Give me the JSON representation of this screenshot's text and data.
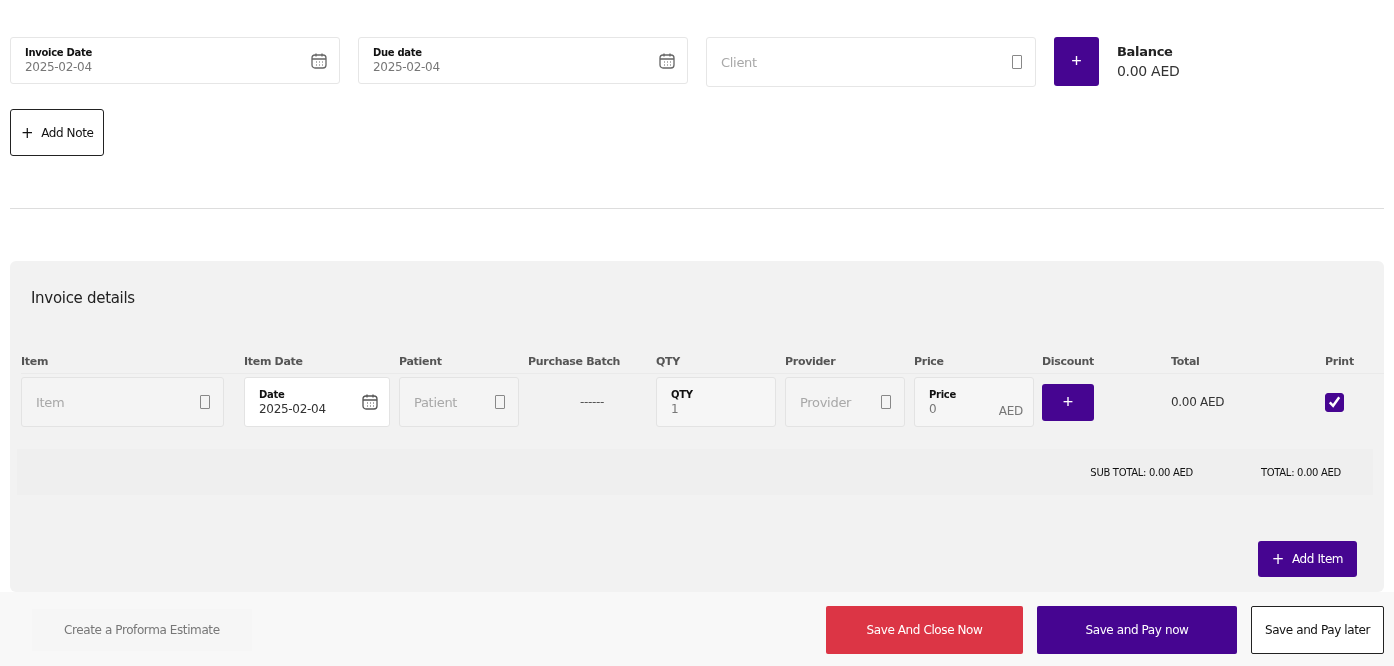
{
  "header": {
    "invoice_date": {
      "label": "Invoice Date",
      "value": "2025-02-04"
    },
    "due_date": {
      "label": "Due date",
      "value": "2025-02-04"
    },
    "client": {
      "placeholder": "Client"
    },
    "add_client_button": "+",
    "balance": {
      "label": "Balance",
      "value": "0.00 AED"
    },
    "add_note_button": {
      "icon": "+",
      "label": "Add Note"
    }
  },
  "invoice_details": {
    "title": "Invoice details",
    "columns": [
      "Item",
      "Item Date",
      "Patient",
      "Purchase Batch",
      "QTY",
      "Provider",
      "Price",
      "Discount",
      "Total",
      "Print"
    ],
    "rows": [
      {
        "item": {
          "placeholder": "Item"
        },
        "item_date": {
          "label": "Date",
          "value": "2025-02-04"
        },
        "patient": {
          "placeholder": "Patient"
        },
        "purchase_batch": "------",
        "qty": {
          "label": "QTY",
          "value": "1"
        },
        "provider": {
          "placeholder": "Provider"
        },
        "price": {
          "label": "Price",
          "value": "0",
          "unit": "AED"
        },
        "discount_button": "+",
        "total": "0.00 AED",
        "print": {
          "checked": true
        }
      }
    ],
    "sub_total": "SUB TOTAL: 0.00 AED",
    "total": "TOTAL: 0.00 AED",
    "add_item_button": {
      "icon": "+",
      "label": "Add Item"
    }
  },
  "footer": {
    "proforma_link": "Create a Proforma Estimate",
    "buttons": [
      {
        "label": "Save And Close Now",
        "kind": "danger"
      },
      {
        "label": "Save and Pay now",
        "kind": "primary"
      },
      {
        "label": "Save and Pay later",
        "kind": "outline"
      }
    ]
  }
}
